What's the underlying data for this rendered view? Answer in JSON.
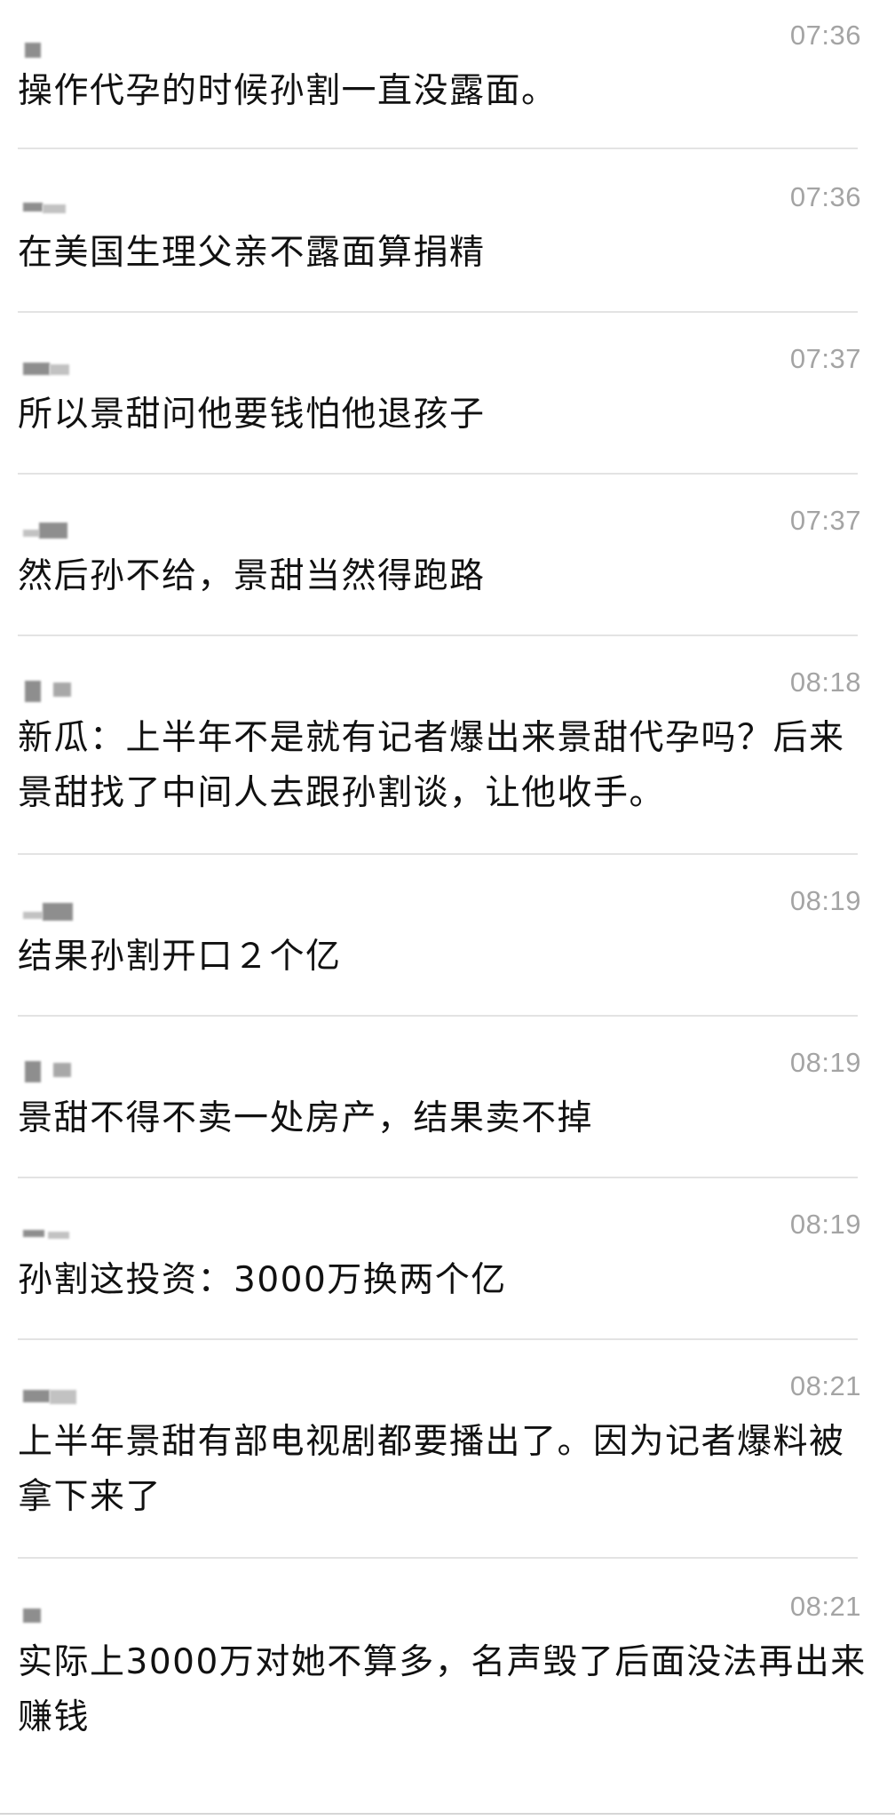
{
  "messages": [
    {
      "time": "07:36",
      "text": "操作代孕的时候孙割一直没露面。"
    },
    {
      "time": "07:36",
      "text": "在美国生理父亲不露面算捐精"
    },
    {
      "time": "07:37",
      "text": "所以景甜问他要钱怕他退孩子"
    },
    {
      "time": "07:37",
      "text": "然后孙不给，景甜当然得跑路"
    },
    {
      "time": "08:18",
      "text": "新瓜：上半年不是就有记者爆出来景甜代孕吗？后来景甜找了中间人去跟孙割谈，让他收手。"
    },
    {
      "time": "08:19",
      "text": "结果孙割开口２个亿"
    },
    {
      "time": "08:19",
      "text": "景甜不得不卖一处房产，结果卖不掉"
    },
    {
      "time": "08:19",
      "text": "孙割这投资：3000万换两个亿"
    },
    {
      "time": "08:21",
      "text": "上半年景甜有部电视剧都要播出了。因为记者爆料被拿下来了"
    },
    {
      "time": "08:21",
      "text": "实际上3000万对她不算多，名声毁了后面没法再出来赚钱"
    }
  ]
}
